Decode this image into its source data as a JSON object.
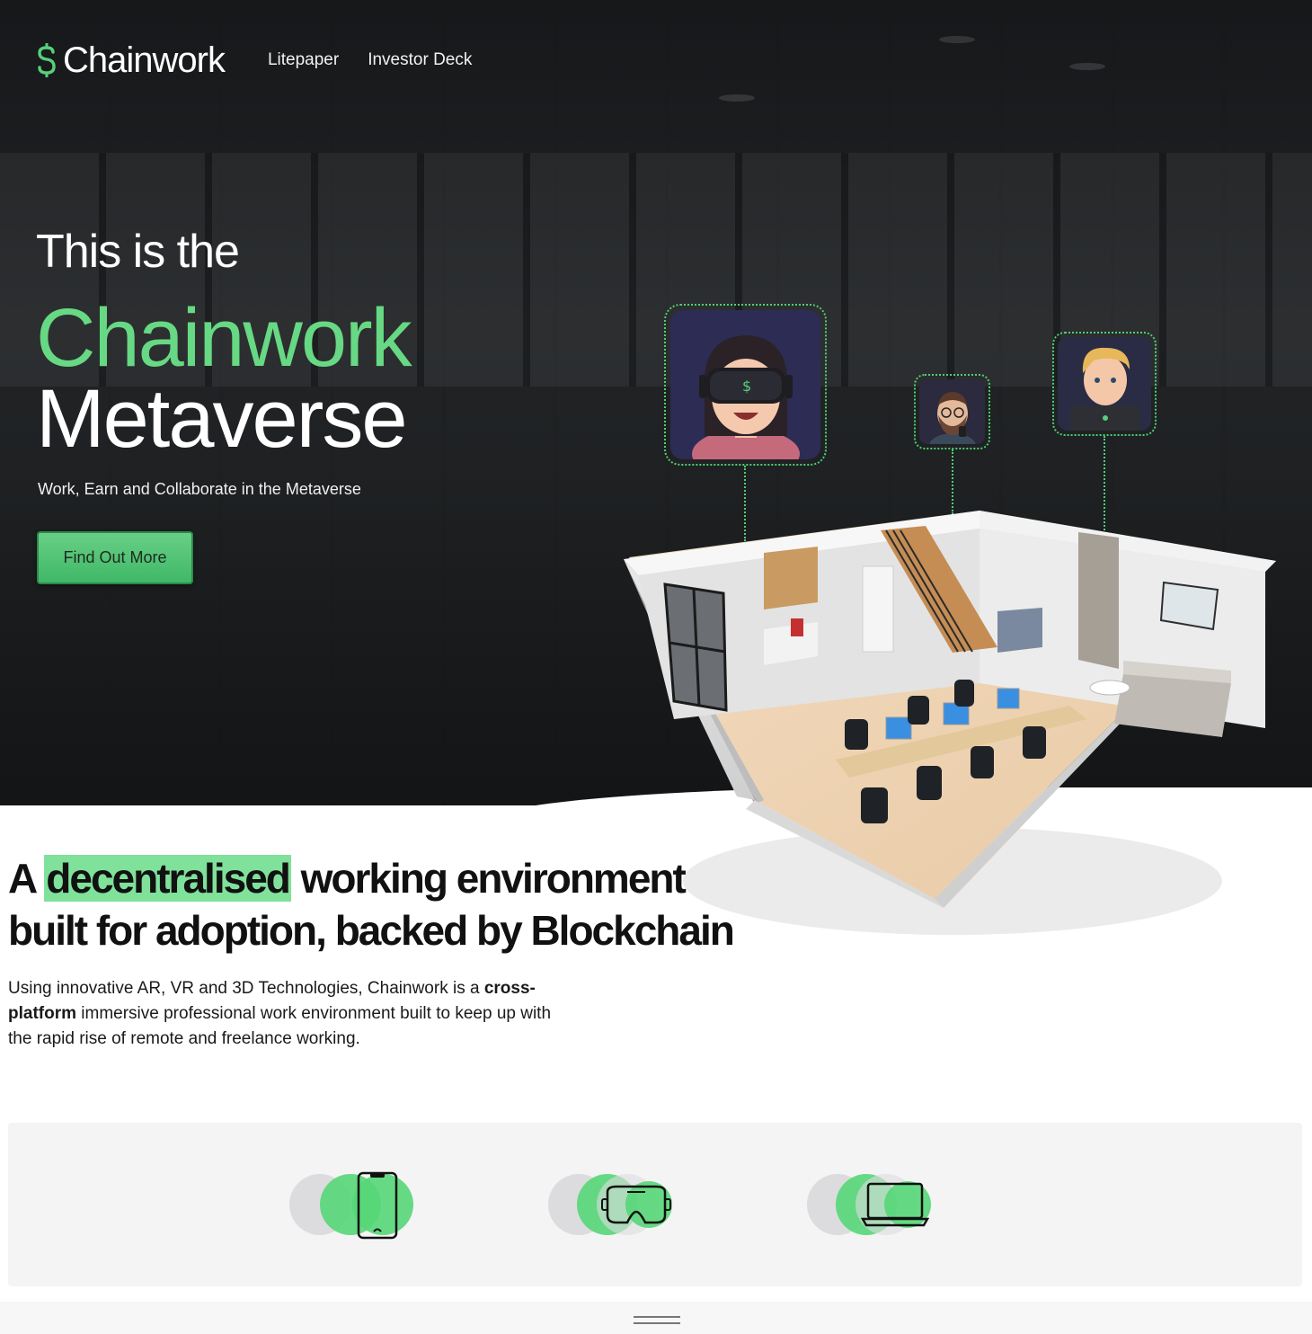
{
  "header": {
    "logo_text": "Chainwork",
    "nav": [
      {
        "label": "Litepaper"
      },
      {
        "label": "Investor Deck"
      }
    ]
  },
  "hero": {
    "pre_title": "This is the",
    "brand_title": "Chainwork",
    "title_line2": "Metaverse",
    "subtitle": "Work, Earn and Collaborate in the Metaverse",
    "cta_label": "Find Out More"
  },
  "intro": {
    "title_start": "A",
    "title_highlight": "decentralised",
    "title_rest": "working environment built for adoption, backed by Blockchain",
    "body_start": "Using innovative AR, VR and 3D Technologies, Chainwork is a",
    "body_bold": "cross-platform",
    "body_end": "immersive professional work environment built to keep up with the rapid rise of remote and freelance working."
  },
  "platforms": [
    {
      "icon": "smartphone-icon"
    },
    {
      "icon": "vr-headset-icon"
    },
    {
      "icon": "laptop-icon"
    }
  ],
  "colors": {
    "accent_green": "#67d883",
    "cta_green": "#4fc471",
    "highlight_green": "#7fe19a",
    "hero_bg": "#1f2224"
  }
}
